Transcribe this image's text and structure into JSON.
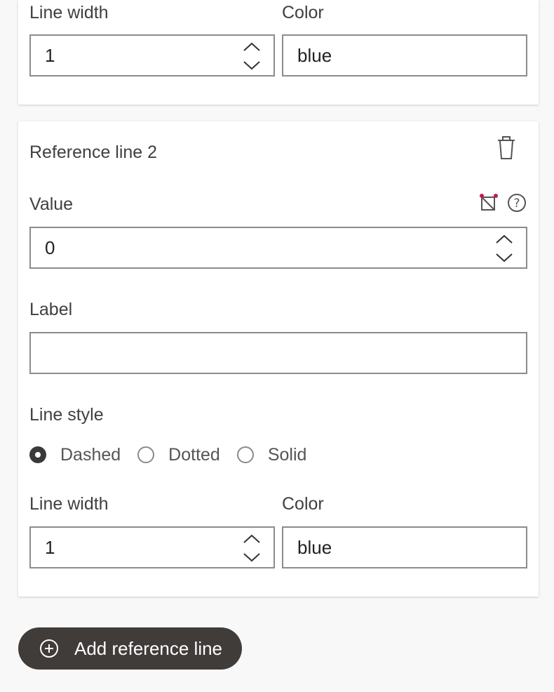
{
  "top_card": {
    "line_width_label": "Line width",
    "line_width_value": "1",
    "color_label": "Color",
    "color_value": "blue"
  },
  "reference_line": {
    "title": "Reference line 2",
    "value_label": "Value",
    "value": "0",
    "label_label": "Label",
    "label_value": "",
    "line_style_label": "Line style",
    "line_style_options": [
      "Dashed",
      "Dotted",
      "Solid"
    ],
    "line_style_selected": "Dashed",
    "line_width_label": "Line width",
    "line_width_value": "1",
    "color_label": "Color",
    "color_value": "blue"
  },
  "add_button_label": "Add reference line",
  "colors": {
    "accent_dot": "#c2185b",
    "button_bg": "#403c3a",
    "border": "#8c8c8c"
  },
  "icons": {
    "delete": "trash-icon",
    "data_binding": "data-binding-icon",
    "help": "help-icon",
    "add": "plus-circle-icon"
  }
}
